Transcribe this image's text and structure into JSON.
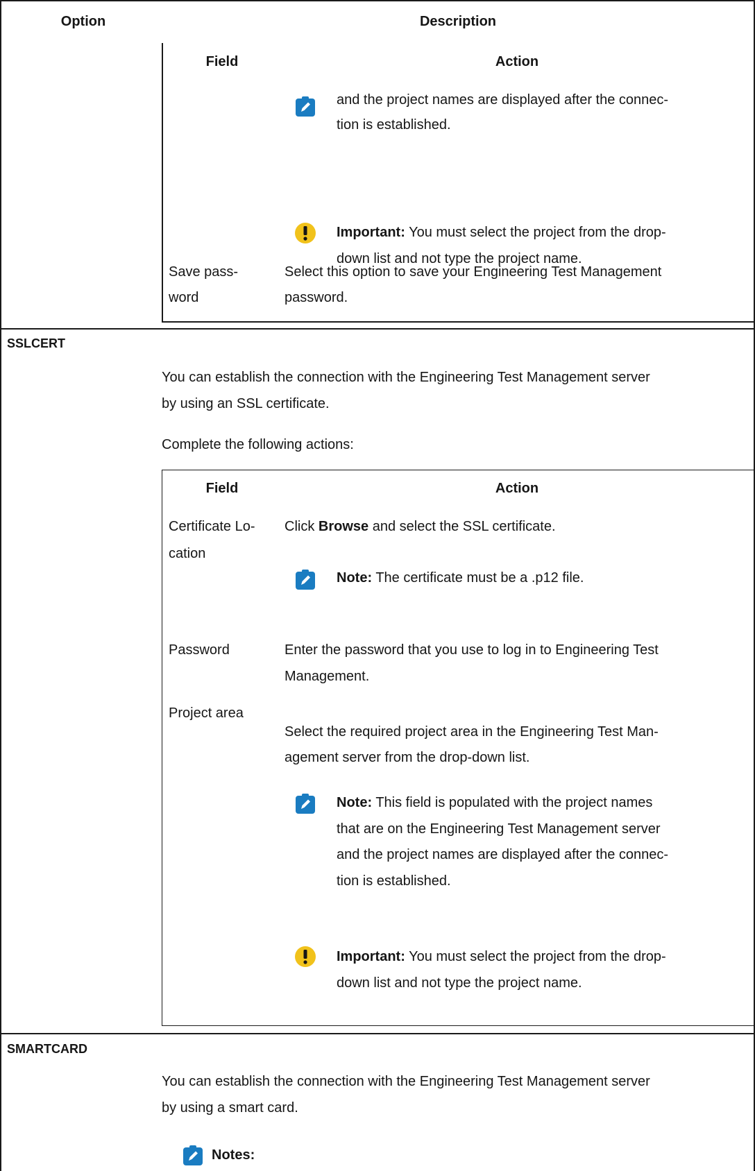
{
  "header": {
    "option": "Option",
    "description": "Description"
  },
  "first_table": {
    "col_field": "Field",
    "col_action": "Action",
    "note_line1": "and the project names are displayed after the connec-",
    "note_line2": "tion is established.",
    "important_label": "Important:",
    "important_line1": "You must select the project from the drop-",
    "important_line2": "down list and not type the project name.",
    "save_field_line1": "Save pass-",
    "save_field_line2": "word",
    "save_action_line1": "Select this option to save your Engineering Test Management",
    "save_action_line2": "password."
  },
  "sslcert": {
    "option": "SSLCERT",
    "intro_line1": "You can establish the connection with the Engineering Test Management server",
    "intro_line2": "by using an SSL certificate.",
    "complete": "Complete the following actions:",
    "col_field": "Field",
    "col_action": "Action",
    "cert_field_line1": "Certificate Lo-",
    "cert_field_line2": "cation",
    "cert_action_pre": "Click ",
    "cert_action_bold": "Browse",
    "cert_action_post": " and select the SSL certificate.",
    "cert_note_label": "Note:",
    "cert_note_text": "The certificate must be a .p12 file.",
    "password_field": "Password",
    "password_action_line1": "Enter the password that you use to log in to Engineering Test",
    "password_action_line2": "Management.",
    "project_field": "Project area",
    "project_action_line1": "Select the required project area in the Engineering Test Man-",
    "project_action_line2": "agement server from the drop-down list.",
    "project_note_label": "Note:",
    "project_note_line1": "This field is populated with the project names",
    "project_note_line2": "that are on the Engineering Test Management server",
    "project_note_line3": "and the project names are displayed after the connec-",
    "project_note_line4": "tion is established.",
    "important_label": "Important:",
    "important_line1": "You must select the project from the drop-",
    "important_line2": "down list and not type the project name."
  },
  "smartcard": {
    "option": "SMARTCARD",
    "intro_line1": "You can establish the connection with the Engineering Test Management server",
    "intro_line2": "by using a smart card.",
    "notes_label": "Notes:"
  },
  "colors": {
    "note_icon": "#1a7cc1",
    "important_icon": "#f1c21b",
    "border": "#1a1a1a"
  }
}
